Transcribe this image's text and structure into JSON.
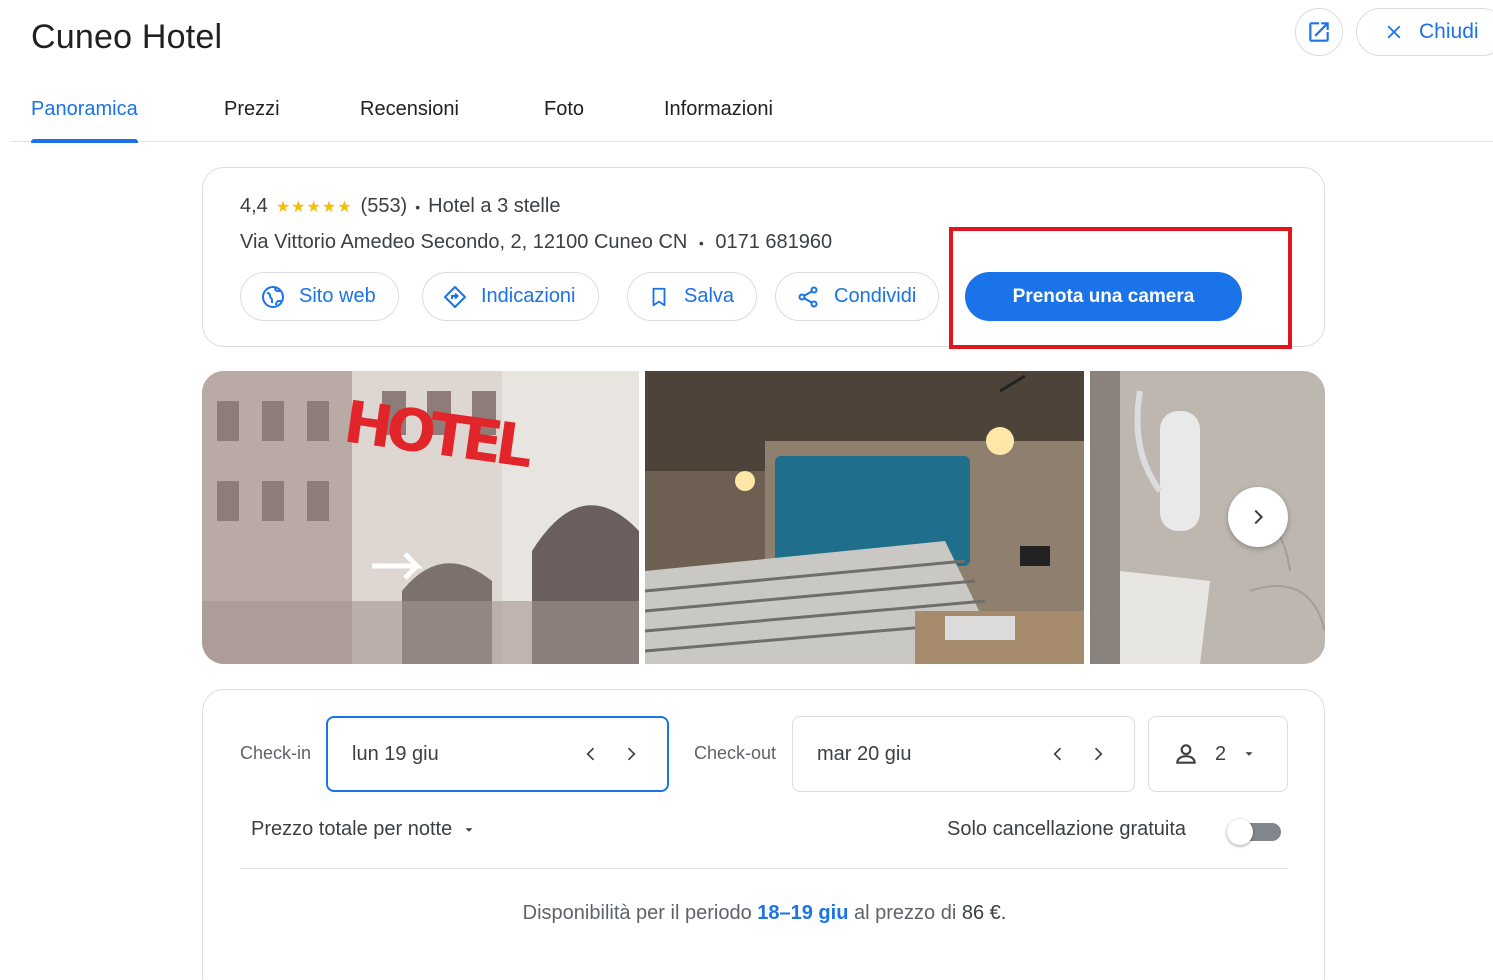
{
  "header": {
    "title": "Cuneo Hotel",
    "open_icon": "open-in-new-icon",
    "close_label": "Chiudi",
    "close_icon": "close-icon"
  },
  "tabs": [
    {
      "label": "Panoramica",
      "active": true
    },
    {
      "label": "Prezzi",
      "active": false
    },
    {
      "label": "Recensioni",
      "active": false
    },
    {
      "label": "Foto",
      "active": false
    },
    {
      "label": "Informazioni",
      "active": false
    }
  ],
  "hotel": {
    "rating": "4,4",
    "stars_display": "★★★★★",
    "reviews": "(553)",
    "separator": "•",
    "category": "Hotel a 3 stelle",
    "address": "Via Vittorio Amedeo Secondo, 2, 12100 Cuneo CN",
    "phone": "0171 681960"
  },
  "actions": {
    "website": "Sito web",
    "directions": "Indicazioni",
    "save": "Salva",
    "share": "Condividi",
    "book": "Prenota una camera"
  },
  "booking": {
    "checkin_label": "Check-in",
    "checkin_value": "lun 19 giu",
    "checkout_label": "Check-out",
    "checkout_value": "mar 20 giu",
    "guests": "2",
    "price_mode": "Prezzo totale per notte",
    "free_cancel": "Solo cancellazione gratuita",
    "avail_prefix": "Disponibilità per il periodo",
    "avail_dates": "18–19 giu",
    "avail_middle": "al prezzo di",
    "avail_price": "86 €."
  },
  "photo_overlay": {
    "sign_text": "HOTEL"
  },
  "colors": {
    "accent": "#1a73e8",
    "star": "#fbbc04",
    "highlight": "#e0161c",
    "border": "#dadce0"
  }
}
